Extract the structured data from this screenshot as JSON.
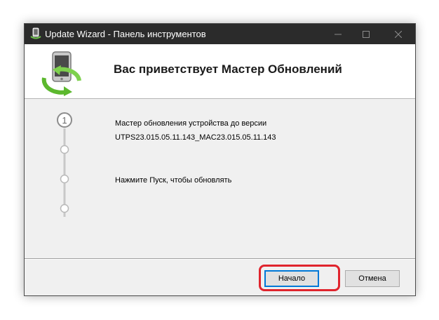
{
  "window": {
    "title": "Update Wizard - Панель инструментов",
    "controls": {
      "minimize_icon": "minimize-icon",
      "maximize_icon": "maximize-icon",
      "close_icon": "close-icon"
    }
  },
  "header": {
    "title": "Вас приветствует Мастер Обновлений",
    "icon": "phone-update-icon"
  },
  "steps": {
    "current_number": "1",
    "line1": "Мастер обновления устройства до версии",
    "version": "UTPS23.015.05.11.143_MAC23.015.05.11.143",
    "line2": "Нажмите Пуск, чтобы обновлять"
  },
  "buttons": {
    "start_label": "Начало",
    "cancel_label": "Отмена"
  },
  "colors": {
    "titlebar": "#2b2b2b",
    "highlight": "#e0242d",
    "accent": "#0078d7"
  }
}
